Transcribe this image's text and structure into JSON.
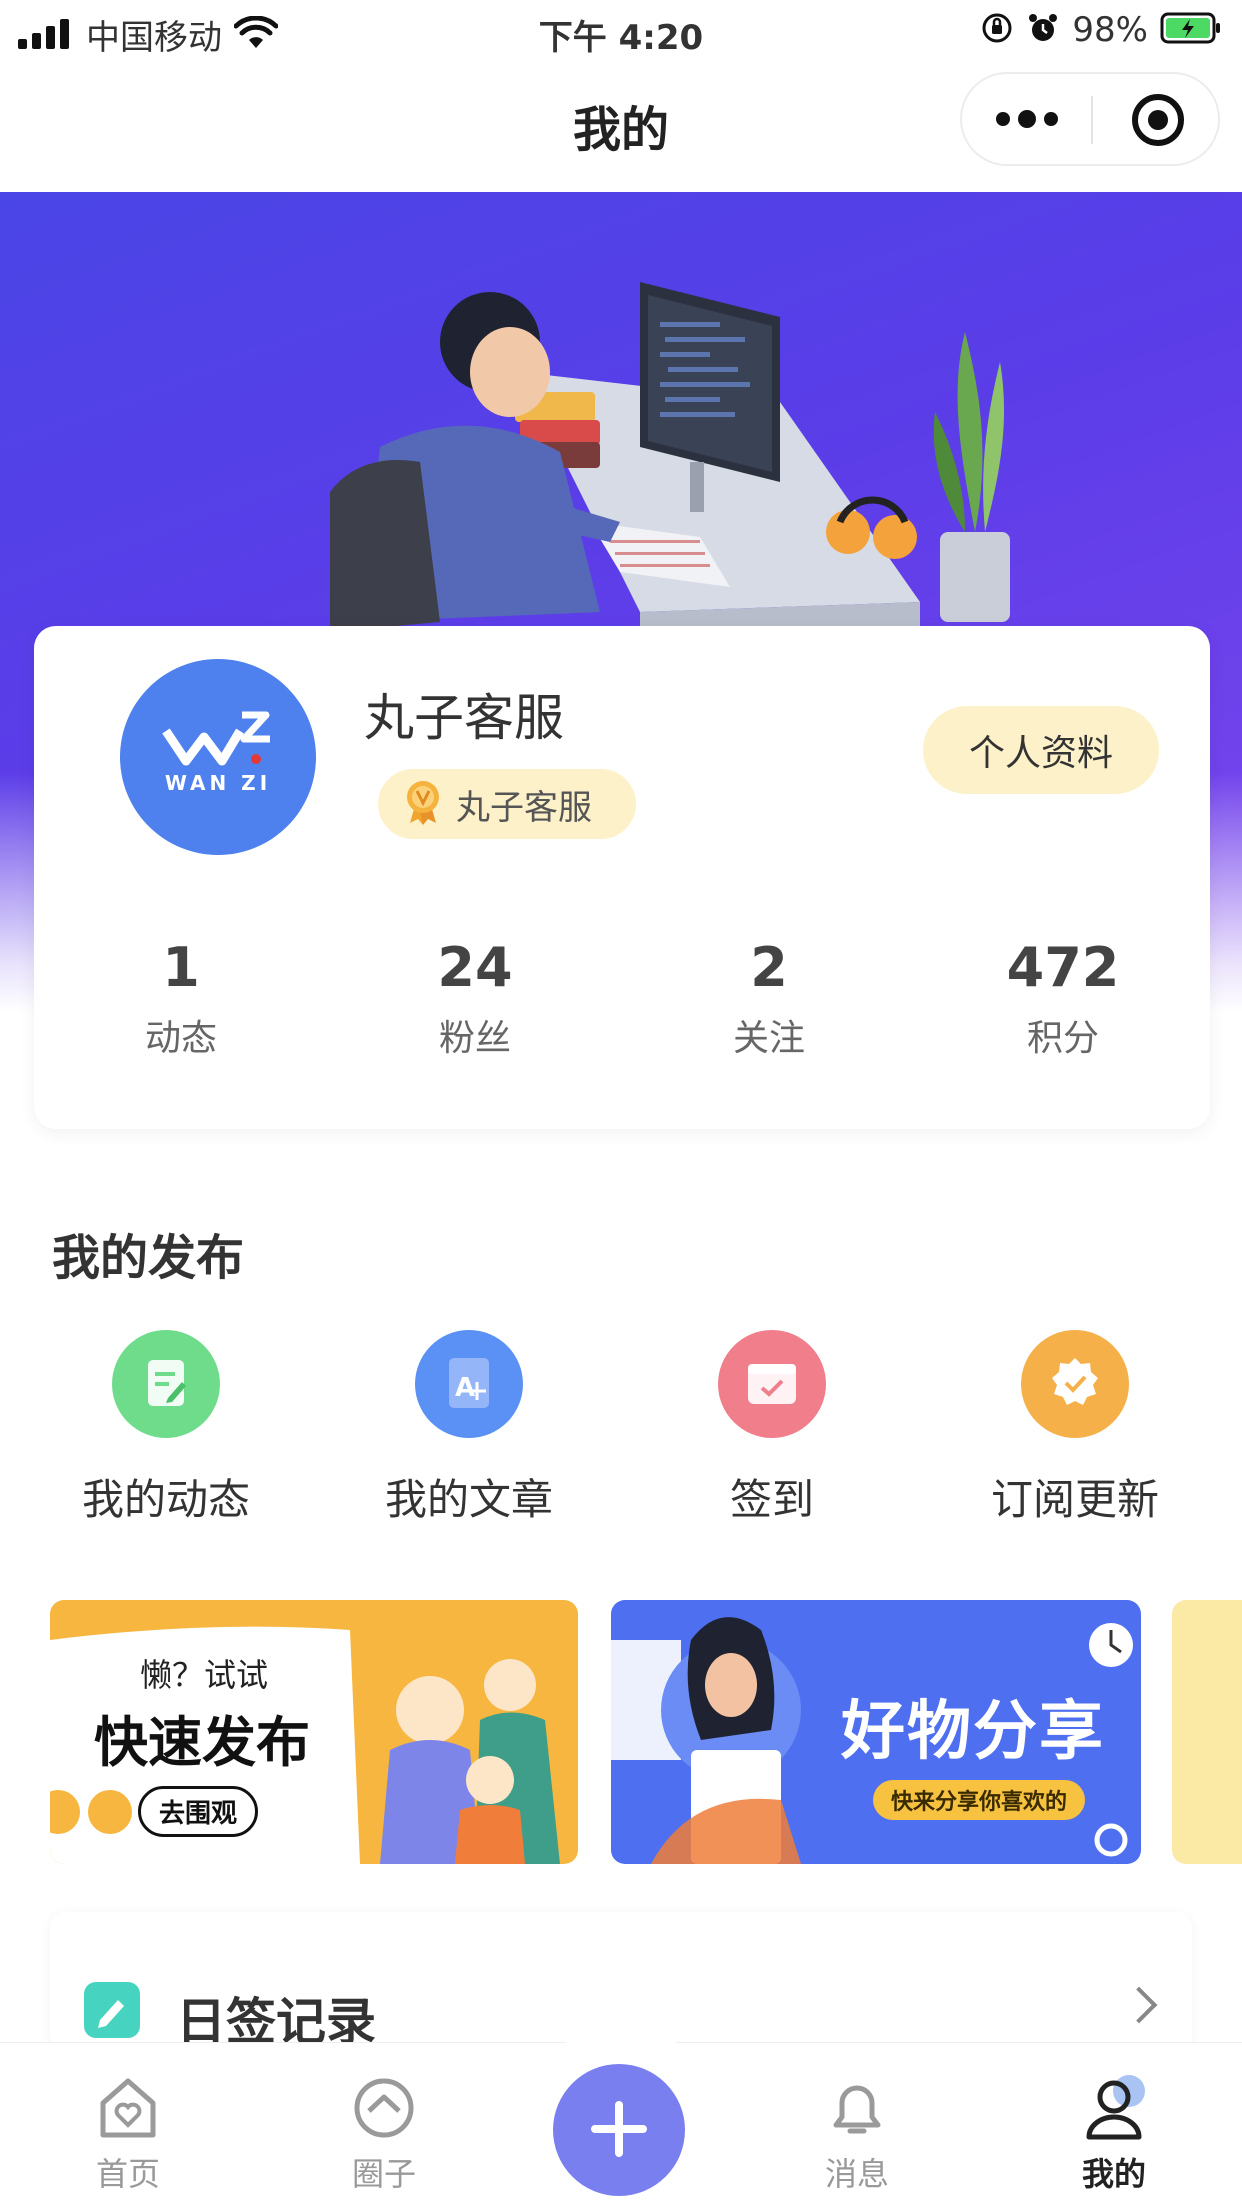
{
  "status_bar": {
    "carrier": "中国移动",
    "time": "下午 4:20",
    "battery": "98%",
    "icons": [
      "signal-icon",
      "wifi-icon",
      "orientation-lock-icon",
      "alarm-icon",
      "battery-charging-icon"
    ]
  },
  "nav": {
    "title": "我的",
    "more_icon": "more-dots-icon",
    "close_icon": "target-circle-icon"
  },
  "profile": {
    "avatar_text_top": "WZ",
    "avatar_text_bottom": "WAN ZI",
    "username": "丸子客服",
    "badge_label": "丸子客服",
    "badge_icon": "medal-icon",
    "profile_button": "个人资料",
    "stats": [
      {
        "value": "1",
        "label": "动态"
      },
      {
        "value": "24",
        "label": "粉丝"
      },
      {
        "value": "2",
        "label": "关注"
      },
      {
        "value": "472",
        "label": "积分"
      }
    ]
  },
  "my_posts": {
    "title": "我的发布",
    "items": [
      {
        "label": "我的动态",
        "icon": "edit-note-icon",
        "color": "#6fdc8c"
      },
      {
        "label": "我的文章",
        "icon": "article-icon",
        "color": "#5b90f5"
      },
      {
        "label": "签到",
        "icon": "checkin-icon",
        "color": "#f07e8b"
      },
      {
        "label": "订阅更新",
        "icon": "subscribe-badge-icon",
        "color": "#f5b04a"
      }
    ]
  },
  "banners": {
    "banner1": {
      "small": "懒？试试",
      "big": "快速发布",
      "button": "去围观"
    },
    "banner2": {
      "big": "好物分享",
      "sub": "快来分享你喜欢的"
    }
  },
  "sign_record": {
    "label": "日签记录",
    "icon": "pencil-icon"
  },
  "tabs": [
    {
      "label": "首页",
      "icon": "home-heart-icon",
      "active": false
    },
    {
      "label": "圈子",
      "icon": "circle-home-icon",
      "active": false
    },
    {
      "label": "消息",
      "icon": "bell-icon",
      "active": false
    },
    {
      "label": "我的",
      "icon": "user-icon",
      "active": true
    }
  ],
  "fab_icon": "plus-icon",
  "colors": {
    "hero_start": "#4a45e6",
    "hero_end": "#7d46ee",
    "avatar_bg": "#4e80ee",
    "badge_bg": "#fdf1c9",
    "fab_bg": "#7a7ff0"
  }
}
